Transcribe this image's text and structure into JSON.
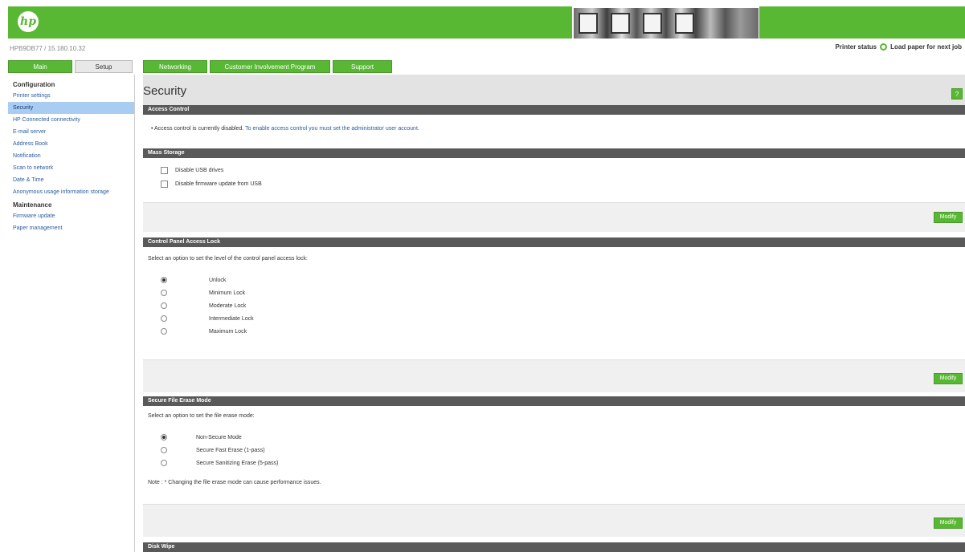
{
  "header": {
    "logo_text": "hp",
    "device_id": "HPB9DB77 / 15.180.10.32",
    "status_label": "Printer status",
    "status_message": "Load paper for next job"
  },
  "tabs": [
    {
      "label": "Main"
    },
    {
      "label": "Setup"
    },
    {
      "label": "Networking"
    },
    {
      "label": "Customer Involvement Program"
    },
    {
      "label": "Support"
    }
  ],
  "sidebar": {
    "config_heading": "Configuration",
    "items": [
      {
        "label": "Printer settings"
      },
      {
        "label": "Security"
      },
      {
        "label": "HP Connected connectivity"
      },
      {
        "label": "E-mail server"
      },
      {
        "label": "Address Book"
      },
      {
        "label": "Notification"
      },
      {
        "label": "Scan to network"
      },
      {
        "label": "Date & Time"
      },
      {
        "label": "Anonymous usage information storage"
      }
    ],
    "maintenance_heading": "Maintenance",
    "maint_items": [
      {
        "label": "Firmware update"
      },
      {
        "label": "Paper management"
      }
    ]
  },
  "main": {
    "title": "Security",
    "help_label": "?",
    "access_control": {
      "header": "Access Control",
      "bullet": "•",
      "text": "Access control is currently disabled.",
      "link": "To enable access control you must set the administrator user account."
    },
    "mass_storage": {
      "header": "Mass Storage",
      "options": [
        {
          "label": "Disable USB drives"
        },
        {
          "label": "Disable firmware update from USB"
        }
      ],
      "button": "Modify"
    },
    "control_panel": {
      "header": "Control Panel Access Lock",
      "instruction": "Select an option to set the level of the control panel access lock:",
      "options": [
        {
          "label": "Unlock",
          "selected": true
        },
        {
          "label": "Minimum Lock",
          "selected": false
        },
        {
          "label": "Moderate Lock",
          "selected": false
        },
        {
          "label": "Intermediate Lock",
          "selected": false
        },
        {
          "label": "Maximum Lock",
          "selected": false
        }
      ],
      "button": "Modify"
    },
    "secure_erase": {
      "header": "Secure File Erase Mode",
      "instruction": "Select an option to set the file erase mode:",
      "options": [
        {
          "label": "Non-Secure Mode",
          "selected": true
        },
        {
          "label": "Secure Fast Erase (1-pass)",
          "selected": false
        },
        {
          "label": "Secure Sanitizing Erase (5-pass)",
          "selected": false
        }
      ],
      "note": "Note : * Changing the file erase mode can cause performance issues.",
      "button": "Modify"
    },
    "disk_wipe": {
      "header": "Disk Wipe"
    }
  },
  "colors": {
    "brand_green": "#59b833",
    "section_header": "#595959",
    "selected_nav": "#a9cdf2",
    "link": "#2b5c9e"
  }
}
